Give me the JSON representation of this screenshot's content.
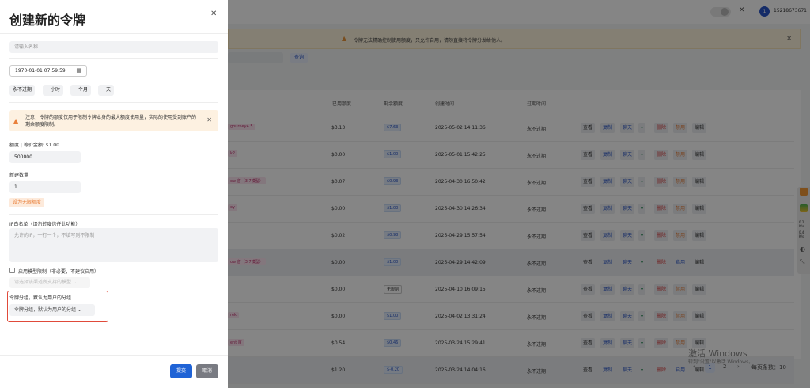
{
  "header": {
    "user": "15218673671",
    "avatar": "1",
    "translate_icon": "translate-icon"
  },
  "banner": {
    "text": "令牌无法精确控制使用额度，只允许自用，请勿直接将令牌分发给他人。"
  },
  "toolbar": {
    "query_label": "查询"
  },
  "table": {
    "headers": [
      "已用额度",
      "剩余额度",
      "创建时间",
      "过期时间"
    ],
    "rows": [
      {
        "name": "gourney4.5",
        "used": "$3.13",
        "remain": "$7.63",
        "created": "2025-05-02 14:11:36",
        "expire": "永不过期",
        "toggle": "禁用"
      },
      {
        "name": "k2",
        "used": "$0.00",
        "remain": "$1.00",
        "created": "2025-05-01 15:42:25",
        "expire": "永不过期",
        "toggle": "禁用"
      },
      {
        "name": "ow 首（3.7模型）",
        "used": "$0.07",
        "remain": "$0.93",
        "created": "2025-04-30 16:50:42",
        "expire": "永不过期",
        "toggle": "禁用"
      },
      {
        "name": "ey",
        "used": "$0.00",
        "remain": "$1.00",
        "created": "2025-04-30 14:26:34",
        "expire": "永不过期",
        "toggle": "禁用"
      },
      {
        "name": "",
        "used": "$0.02",
        "remain": "$0.98",
        "created": "2025-04-29 15:57:54",
        "expire": "永不过期",
        "toggle": "禁用"
      },
      {
        "name": "ow 首（3.7模型）",
        "used": "$0.00",
        "remain": "$1.00",
        "created": "2025-04-29 14:42:09",
        "expire": "永不过期",
        "toggle": "启用"
      },
      {
        "name": "",
        "used": "$0.00",
        "remain": "无限制",
        "created": "2025-04-10 16:09:15",
        "expire": "永不过期",
        "toggle": "禁用"
      },
      {
        "name": "rek",
        "used": "$0.00",
        "remain": "$1.00",
        "created": "2025-04-02 13:31:24",
        "expire": "永不过期",
        "toggle": "禁用"
      },
      {
        "name": "ent 首",
        "used": "$0.54",
        "remain": "$0.46",
        "created": "2025-03-24 15:29:41",
        "expire": "永不过期",
        "toggle": "禁用"
      },
      {
        "name": "",
        "used": "$1.20",
        "remain": "$-0.20",
        "created": "2025-03-24 14:04:16",
        "expire": "永不过期",
        "toggle": "启用"
      }
    ],
    "actions": {
      "view": "查看",
      "copy": "复制",
      "chat": "聊天",
      "delete": "删除",
      "edit": "编辑"
    }
  },
  "pager": {
    "page1": "1",
    "page2": "2",
    "per_page": "每页条数：10"
  },
  "watermark": {
    "line1": "激活 Windows",
    "line2": "转到\"设置\"以激活 Windows。"
  },
  "sidebar_widget": {
    "v1": "0.2",
    "u1": "K/s",
    "v2": "0.4",
    "u2": "K/s"
  },
  "drawer": {
    "title": "创建新的令牌",
    "name_placeholder": "请输入名称",
    "expire_value": "1970-01-01 07:59:59",
    "quick": [
      "永不过期",
      "一小时",
      "一个月",
      "一天"
    ],
    "alert": "注意，令牌的额度仅用于限制令牌本身的最大额度使用量，实际的使用受到账户的剩余额度限制。",
    "quota_label": "额度 | 等价金额: $1.00",
    "quota_value": "500000",
    "count_label": "新建数量",
    "count_value": "1",
    "unlimited_btn": "设为无限额度",
    "ip_label": "IP白名单（请勿过度信任此功能）",
    "ip_placeholder": "允许的IP，一行一个，不填写则不限制",
    "model_limit_label": "启用模型限制（非必要，不建议启用）",
    "model_placeholder": "请选择该渠道所支持的模型",
    "group_label": "令牌分组，默认为用户的分组",
    "group_value": "令牌分组，默认为用户的分组",
    "submit": "提交",
    "cancel": "取消"
  }
}
